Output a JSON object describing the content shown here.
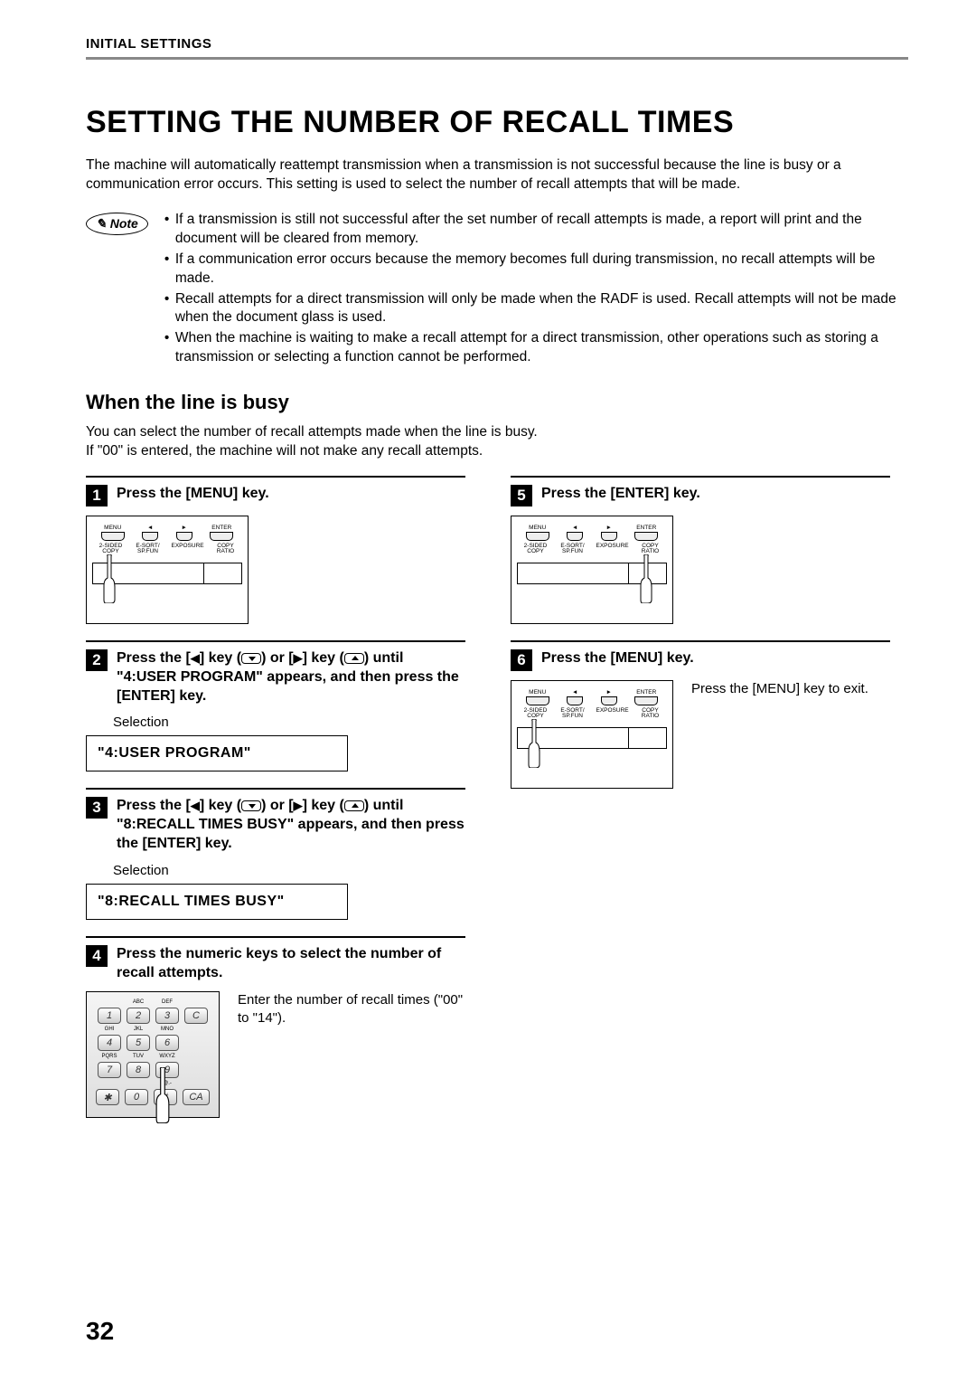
{
  "header": "INITIAL SETTINGS",
  "title": "SETTING THE NUMBER OF RECALL TIMES",
  "intro": "The machine will automatically reattempt transmission when a transmission is not successful because the line is busy or a communication error occurs. This setting is used to select the number of recall attempts that will be made.",
  "note_label": "Note",
  "notes": [
    "If a transmission is still not successful after the set number of recall attempts is made, a report will print and the document will be cleared from memory.",
    "If a communication error occurs because the memory becomes full during transmission, no recall attempts will be made.",
    "Recall attempts for a direct transmission will only be made when the RADF is used. Recall attempts will not be made when the document glass is used.",
    "When the machine is waiting to make a recall attempt for a direct transmission, other operations such as storing a transmission or selecting a function cannot be performed."
  ],
  "section_title": "When the line is busy",
  "section_intro": "You can select the number of recall attempts made when the line is busy.\nIf \"00\" is entered, the machine will not make any recall attempts.",
  "panel_labels": {
    "menu": "MENU",
    "enter": "ENTER",
    "twosided": "2-SIDED\nCOPY",
    "esort": "E-SORT/\nSP.FUN",
    "exposure": "EXPOSURE",
    "ratio": "COPY\nRATIO"
  },
  "steps": {
    "s1": {
      "num": "1",
      "title": "Press the [MENU] key."
    },
    "s2": {
      "num": "2",
      "title_pre": "Press the [",
      "title_mid1": "] key (",
      "title_mid2": ") or [",
      "title_mid3": "] key (",
      "title_post": ") until \"4:USER PROGRAM\" appears, and then press the [ENTER] key.",
      "selection_label": "Selection",
      "lcd": "\"4:USER PROGRAM\""
    },
    "s3": {
      "num": "3",
      "title_pre": "Press the [",
      "title_mid1": "] key (",
      "title_mid2": ") or [",
      "title_mid3": "] key (",
      "title_post": ") until \"8:RECALL TIMES BUSY\" appears, and then press the [ENTER] key.",
      "selection_label": "Selection",
      "lcd": "\"8:RECALL TIMES BUSY\""
    },
    "s4": {
      "num": "4",
      "title": "Press the numeric keys to select the number of recall attempts.",
      "side": "Enter the number of recall times (\"00\" to \"14\")."
    },
    "s5": {
      "num": "5",
      "title": "Press the [ENTER] key."
    },
    "s6": {
      "num": "6",
      "title": "Press the [MENU] key.",
      "side": "Press the [MENU] key to exit."
    }
  },
  "page_number": "32"
}
